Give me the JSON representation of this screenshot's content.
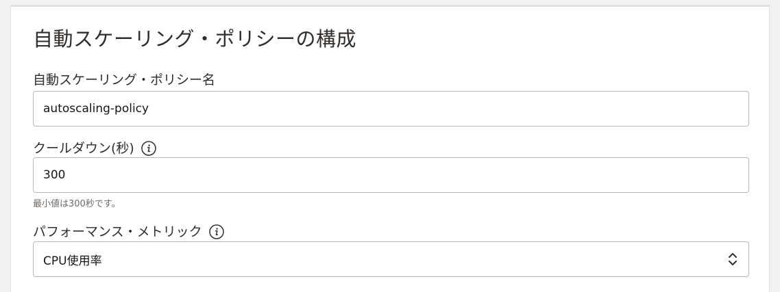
{
  "dialog": {
    "title": "自動スケーリング・ポリシーの構成"
  },
  "policy_name": {
    "label": "自動スケーリング・ポリシー名",
    "value": "autoscaling-policy"
  },
  "cooldown": {
    "label": "クールダウン(秒)",
    "value": "300",
    "hint": "最小値は300秒です。",
    "info_icon": "info-icon"
  },
  "performance_metric": {
    "label": "パフォーマンス・メトリック",
    "selected": "CPU使用率",
    "info_icon": "info-icon",
    "select_icon": "chevron-up-down-icon"
  },
  "colors": {
    "border": "#bcb6b1",
    "text": "#312d2a",
    "hint": "#6f6a66"
  }
}
